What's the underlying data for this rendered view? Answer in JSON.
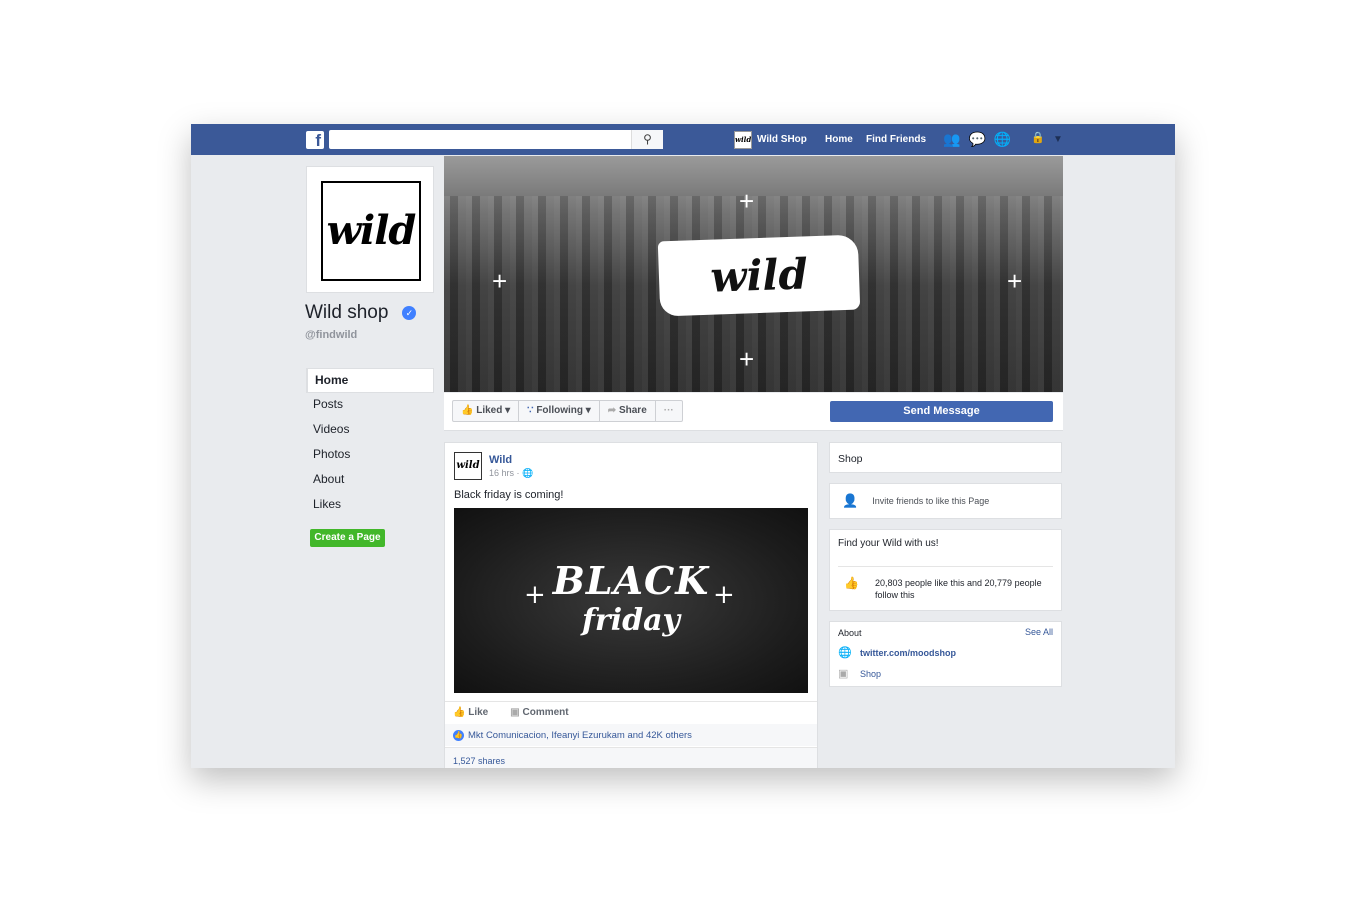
{
  "navbar": {
    "logo": "f",
    "search_placeholder": "",
    "search_icon": "search-icon",
    "page_name": "Wild SHop",
    "page_avatar": "wild",
    "links": [
      "Home",
      "Find Friends"
    ],
    "icons": [
      "friend-requests-icon",
      "messages-icon",
      "notifications-icon",
      "privacy-icon",
      "dropdown-arrow-icon"
    ]
  },
  "profile": {
    "logo_text": "wild",
    "name": "Wild shop",
    "handle": "@findwild",
    "verified": true
  },
  "sidebar": {
    "items": [
      {
        "label": "Home",
        "active": true
      },
      {
        "label": "Posts"
      },
      {
        "label": "Videos"
      },
      {
        "label": "Photos"
      },
      {
        "label": "About"
      },
      {
        "label": "Likes"
      }
    ],
    "create_page": "Create a Page"
  },
  "cover": {
    "logo_text": "wild"
  },
  "actions": {
    "liked": "Liked",
    "following": "Following",
    "share": "Share",
    "more": "···",
    "send_message": "Send Message"
  },
  "post": {
    "author": "Wild",
    "avatar_text": "wild",
    "time": "16 hrs ·",
    "text": "Black friday is coming!",
    "image_text_1": "BLACK",
    "image_text_2": "friday",
    "like": "Like",
    "comment": "Comment",
    "likes_text": "Mkt Comunicacion, Ifeanyi Ezurukam and 42K others",
    "shares": "1,527 shares"
  },
  "right": {
    "shop": "Shop",
    "invite": "Invite friends to like this Page",
    "tagline": "Find your Wild with us!",
    "stats": "20,803 people like this and 20,779 people follow this",
    "about_title": "About",
    "see_all": "See All",
    "about_items": [
      "twitter.com/moodshop",
      "Shop"
    ]
  },
  "colors": {
    "brand": "#3b5998",
    "button": "#4267b2",
    "green": "#42b72a",
    "link": "#365899"
  }
}
